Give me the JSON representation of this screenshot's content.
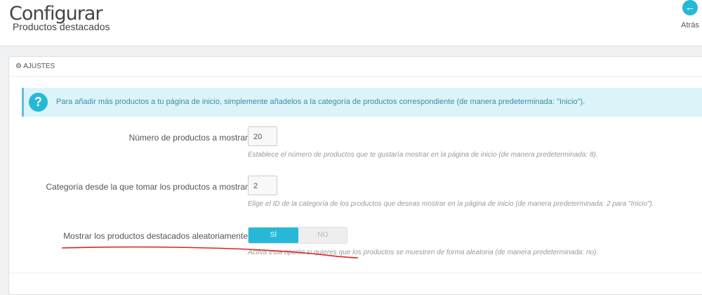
{
  "header": {
    "title": "Configurar",
    "subtitle": "Productos destacados",
    "back_label": "Atrás",
    "back_icon": "arrow-left-circle-icon"
  },
  "panel": {
    "title": "AJUSTES",
    "icon": "cogs-icon"
  },
  "alert": {
    "icon": "question-icon",
    "text": "Para añadir más productos a tu página de inicio, simplemente añadelos a la categoría de productos correspondiente (de manera predeterminada: \"Inicio\")."
  },
  "fields": [
    {
      "label": "Número de productos a mostrar",
      "value": "20",
      "help": "Establece el número de productos que te gustaría mostrar en la página de inicio (de manera predeterminada: 8)."
    },
    {
      "label": "Categoría desde la que tomar los productos a mostrar",
      "value": "2",
      "help": "Elige el ID de la categoría de los productos que deseas mostrar en la página de inicio (de manera predeterminada: 2 para \"Inicio\")."
    },
    {
      "label": "Mostrar los productos destacados aleatoriamente",
      "yes": "SÍ",
      "no": "NO",
      "selected": "SÍ",
      "help": "Activa esta opción si quieres que los productos se muestren de forma aleatoria (de manera predeterminada: no)."
    }
  ],
  "colors": {
    "accent": "#25b9d7",
    "annotation": "#e02020"
  }
}
